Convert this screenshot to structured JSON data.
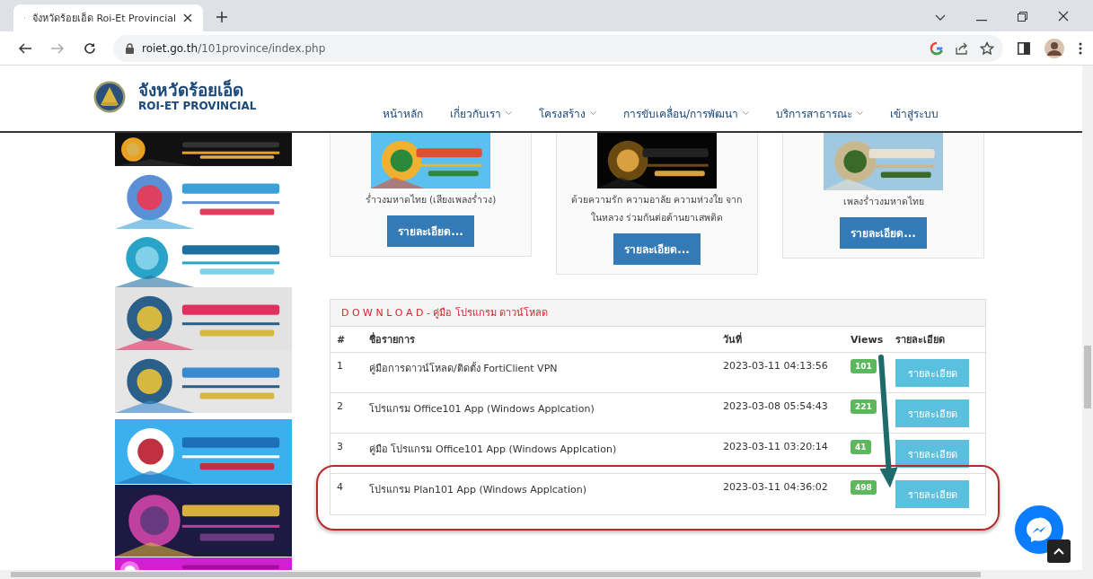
{
  "browser": {
    "tab_title": "จังหวัดร้อยเอ็ด Roi-Et Provincial",
    "url": {
      "host": "roiet.go.th",
      "path": "/101province/index.php"
    }
  },
  "site": {
    "title": "จังหวัดร้อยเอ็ด",
    "subtitle": "ROI-ET PROVINCIAL"
  },
  "nav": [
    {
      "label": "หน้าหลัก",
      "has_menu": false
    },
    {
      "label": "เกี่ยวกับเรา",
      "has_menu": true
    },
    {
      "label": "โครงสร้าง",
      "has_menu": true
    },
    {
      "label": "การขับเคลื่อน/การพัฒนา",
      "has_menu": true
    },
    {
      "label": "บริการสาธารณะ",
      "has_menu": true
    },
    {
      "label": "เข้าสู่ระบบ",
      "has_menu": false
    }
  ],
  "videos": [
    {
      "kind": "picture",
      "caption": "ร่ำวงมหาดไทย (เสียงเพลงร่ำวง)",
      "button": "รายละเอียด..."
    },
    {
      "kind": "picture",
      "caption": "ด้วยความรัก ความอาลัย ความห่วงใย จาก ในหลวง ร่วมกันต่อต้านยาเสพติด",
      "button": "รายละเอียด..."
    },
    {
      "kind": "picture",
      "caption": "เพลงร่ำวงมหาดไทย",
      "button": "รายละเอียด..."
    }
  ],
  "downloads": {
    "title_lead": "D O W N L O A D",
    "title": " - คู่มือ โปรแกรม ดาวน์โหลด",
    "columns": [
      "#",
      "ชื่อรายการ",
      "วันที่",
      "Views",
      "รายละเอียด"
    ],
    "rows": [
      {
        "no": "1",
        "name": "คู่มือการดาวน์โหลด/ติดตั้ง FortiClient VPN",
        "date": "2023-03-11 04:13:56",
        "views": "101",
        "button": "รายละเอียด",
        "circled": false
      },
      {
        "no": "2",
        "name": "โปรแกรม Office101 App (Windows Applcation)",
        "date": "2023-03-08 05:54:43",
        "views": "221",
        "button": "รายละเอียด",
        "circled": false
      },
      {
        "no": "3",
        "name": "คู่มือ โปรแกรม Office101 App (Windows Applcation)",
        "date": "2023-03-11 03:20:14",
        "views": "41",
        "button": "รายละเอียด",
        "circled": false
      },
      {
        "no": "4",
        "name": "โปรแกรม Plan101 App (Windows Applcation)",
        "date": "2023-03-11 04:36:02",
        "views": "498",
        "button": "รายละเอียด",
        "circled": true
      }
    ]
  }
}
